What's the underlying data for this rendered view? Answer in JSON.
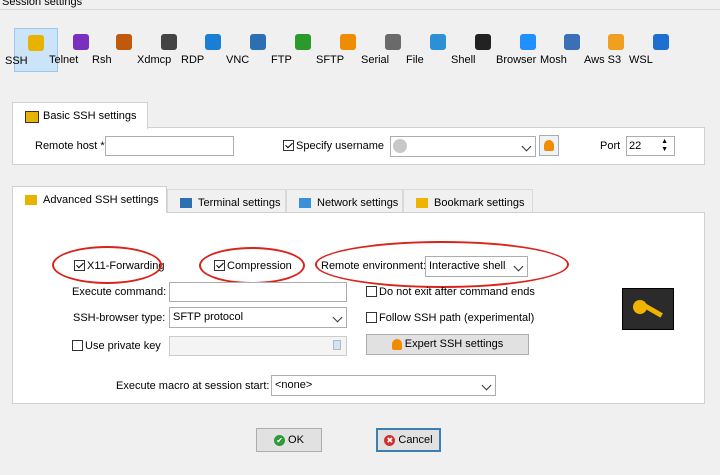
{
  "window": {
    "title": "Session settings"
  },
  "protocols": [
    {
      "label": "SSH",
      "icon": "ssh-icon",
      "color": "#e8b200",
      "selected": true
    },
    {
      "label": "Telnet",
      "icon": "telnet-icon",
      "color": "#7b2fbe"
    },
    {
      "label": "Rsh",
      "icon": "rsh-icon",
      "color": "#c05a0a"
    },
    {
      "label": "Xdmcp",
      "icon": "xdmcp-icon",
      "color": "#444444"
    },
    {
      "label": "RDP",
      "icon": "rdp-icon",
      "color": "#1a7fd4"
    },
    {
      "label": "VNC",
      "icon": "vnc-icon",
      "color": "#2d6fb3"
    },
    {
      "label": "FTP",
      "icon": "ftp-icon",
      "color": "#2a9a2a"
    },
    {
      "label": "SFTP",
      "icon": "sftp-icon",
      "color": "#f08c00"
    },
    {
      "label": "Serial",
      "icon": "serial-icon",
      "color": "#6a6a6a"
    },
    {
      "label": "File",
      "icon": "file-icon",
      "color": "#2d8fd6"
    },
    {
      "label": "Shell",
      "icon": "shell-icon",
      "color": "#222222"
    },
    {
      "label": "Browser",
      "icon": "browser-icon",
      "color": "#1e90ff"
    },
    {
      "label": "Mosh",
      "icon": "mosh-icon",
      "color": "#3b6fb6"
    },
    {
      "label": "Aws S3",
      "icon": "aws-s3-icon",
      "color": "#f0a020"
    },
    {
      "label": "WSL",
      "icon": "wsl-icon",
      "color": "#1f6fd0"
    }
  ],
  "basic": {
    "tab_label": "Basic SSH settings",
    "remote_host_label": "Remote host *",
    "remote_host_value": "",
    "specify_username_label": "Specify username",
    "specify_username_checked": true,
    "username_value": "",
    "port_label": "Port",
    "port_value": "22"
  },
  "tabs": [
    {
      "label": "Advanced SSH settings",
      "icon": "ssh-key-icon",
      "active": true
    },
    {
      "label": "Terminal settings",
      "icon": "terminal-icon"
    },
    {
      "label": "Network settings",
      "icon": "network-icon"
    },
    {
      "label": "Bookmark settings",
      "icon": "star-icon"
    }
  ],
  "advanced": {
    "x11_label": "X11-Forwarding",
    "x11_checked": true,
    "compression_label": "Compression",
    "compression_checked": true,
    "remote_env_label": "Remote environment:",
    "remote_env_value": "Interactive shell",
    "execute_command_label": "Execute command:",
    "execute_command_value": "",
    "do_not_exit_label": "Do not exit after command ends",
    "do_not_exit_checked": false,
    "ssh_browser_label": "SSH-browser type:",
    "ssh_browser_value": "SFTP protocol",
    "follow_ssh_label": "Follow SSH path (experimental)",
    "follow_ssh_checked": false,
    "use_private_key_label": "Use private key",
    "use_private_key_checked": false,
    "private_key_value": "",
    "expert_button_label": "Expert SSH settings",
    "macro_label": "Execute macro at session start:",
    "macro_value": "<none>"
  },
  "buttons": {
    "ok_label": "OK",
    "cancel_label": "Cancel"
  },
  "colors": {
    "accent": "#cce4f7",
    "highlight": "#d9231b",
    "ok_icon": "#2e9b3a",
    "cancel_icon": "#d32f2f"
  }
}
